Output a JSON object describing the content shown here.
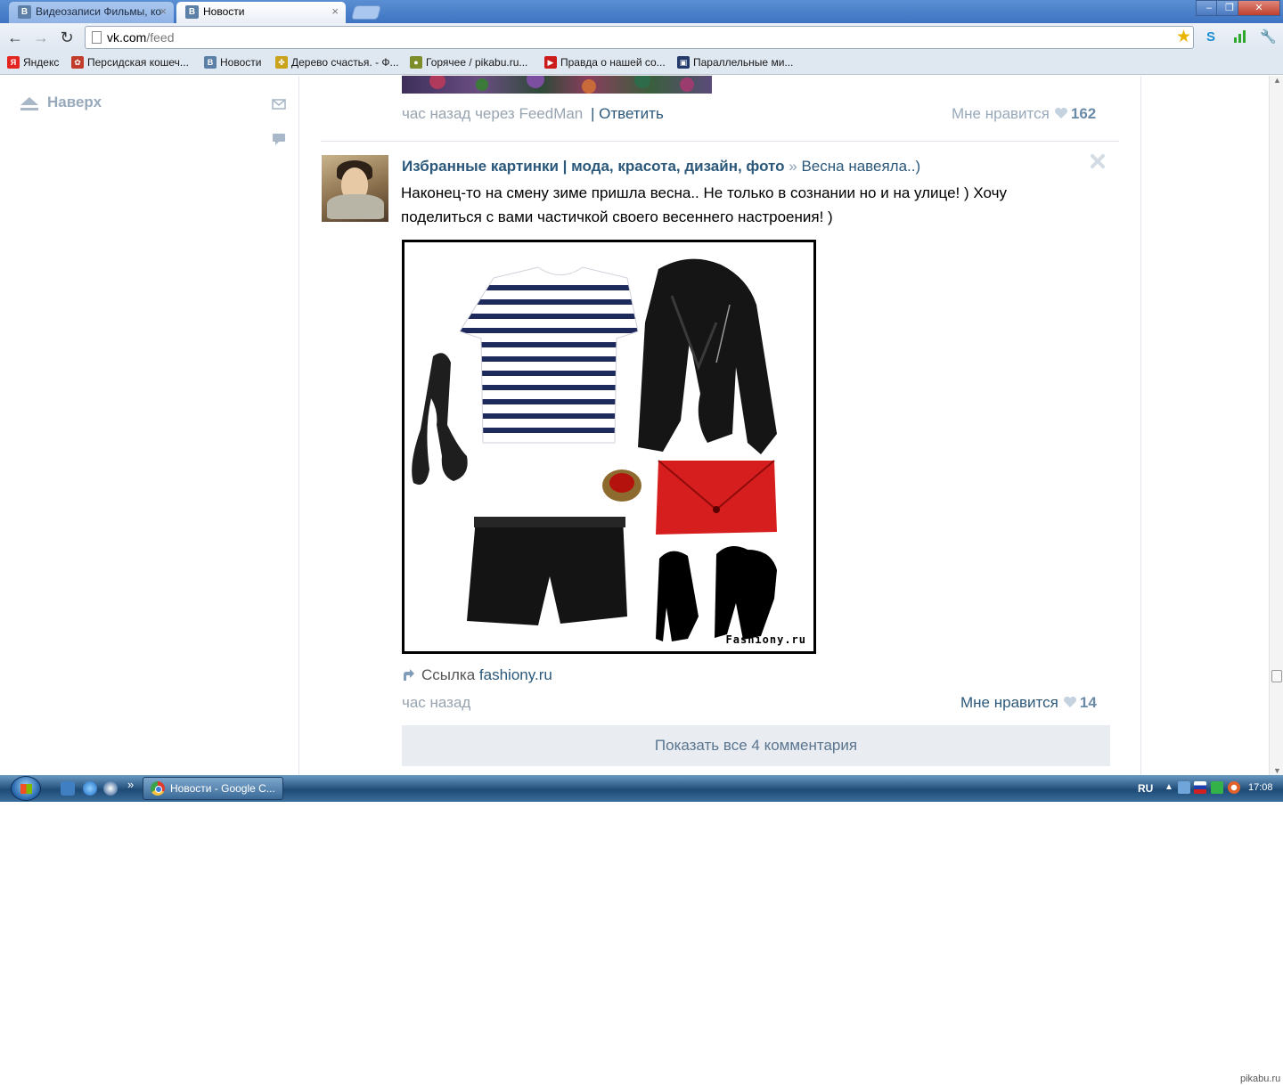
{
  "browser": {
    "tabs": [
      {
        "label": "Видеозаписи Фильмы, ко",
        "favicon": "В",
        "active": false
      },
      {
        "label": "Новости",
        "favicon": "В",
        "active": true
      }
    ],
    "window_buttons": {
      "minimize": "–",
      "restore": "❐",
      "close": "✕"
    },
    "address": {
      "domain": "vk.com",
      "path": "/feed"
    },
    "bookmarks": [
      {
        "label": "Яндекс",
        "icon": "yandex-icon",
        "color": "#e52620",
        "glyph": "Я"
      },
      {
        "label": "Персидская кошеч...",
        "icon": "flower-icon",
        "color": "#c23c2c",
        "glyph": "✿"
      },
      {
        "label": "Новости",
        "icon": "vk-icon",
        "color": "#5b7fa6",
        "glyph": "В"
      },
      {
        "label": "Дерево счастья. - Ф...",
        "icon": "tree-icon",
        "color": "#caa21c",
        "glyph": "✤"
      },
      {
        "label": "Горячее / pikabu.ru...",
        "icon": "pikabu-icon",
        "color": "#7c8d2a",
        "glyph": "●"
      },
      {
        "label": "Правда о нашей со...",
        "icon": "youtube-icon",
        "color": "#cc1b1b",
        "glyph": "▶"
      },
      {
        "label": "Параллельные ми...",
        "icon": "clapper-icon",
        "color": "#243a6b",
        "glyph": "▣"
      }
    ]
  },
  "sidebar": {
    "scroll_top_label": "Наверх"
  },
  "feed": {
    "previous_post": {
      "time": "час назад через FeedMan",
      "separator": "|",
      "reply_label": "Ответить",
      "like_label": "Мне нравится",
      "like_count": "162"
    },
    "post": {
      "author": "Избранные картинки | мода, красота, дизайн, фото",
      "separator": "»",
      "subtitle": "Весна навеяла..)",
      "text": "Наконец-то на смену зиме пришла весна.. Не только в сознании но и на улице! ) Хочу поделиться с вами частичкой своего весеннего настроения! )",
      "image_watermark": "Fashiony.ru",
      "link_label": "Ссылка",
      "link_url": "fashiony.ru",
      "time": "час назад",
      "like_label": "Мне нравится",
      "like_count": "14",
      "show_comments": "Показать все 4 комментария"
    }
  },
  "taskbar": {
    "task_label": "Новости - Google C...",
    "language": "RU",
    "clock": "17:08",
    "quick_launch_more": "»"
  },
  "footer_mark": "pikabu.ru",
  "colors": {
    "vk_link": "#2b587a",
    "meta_gray": "#98a4b0",
    "comments_bg": "#e9edf1",
    "taskbar": "#2d5a86"
  }
}
